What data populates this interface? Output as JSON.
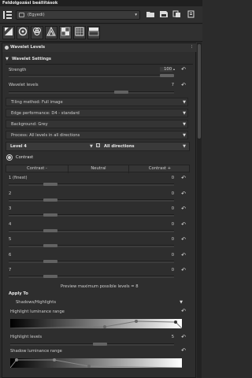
{
  "window": {
    "title": "Feldolgozási beállítások"
  },
  "toolbar": {
    "profile": "(Egyedi)"
  },
  "tabs": [
    "exposure",
    "detail",
    "color",
    "transform",
    "raw",
    "metadata"
  ],
  "sections": {
    "wavelet_levels": "Wavelet Levels",
    "wavelet_settings": "Wavelet Settings",
    "contrast": "Contrast",
    "apply_to": "Apply To"
  },
  "settings": {
    "strength_label": "Strength",
    "strength_value": "100",
    "strength_fraction": 1.0,
    "wavelet_levels_label": "Wavelet levels",
    "wavelet_levels_value": "7",
    "wavelet_levels_fraction": 0.7,
    "tiling_method": "Tiling method:   Full image",
    "edge_performance": "Edge performance:   D4 - standard",
    "background": "Background:   Grey",
    "process": "Process:   All levels in all directions",
    "level": "Level 4",
    "direction": "All directions"
  },
  "contrast": {
    "columns": [
      "Contrast -",
      "Neutral",
      "Contrast +"
    ],
    "rows": [
      {
        "label": "1 (finest)",
        "value": "0"
      },
      {
        "label": "2",
        "value": "0"
      },
      {
        "label": "3",
        "value": "0"
      },
      {
        "label": "4",
        "value": "0"
      },
      {
        "label": "5",
        "value": "0"
      },
      {
        "label": "6",
        "value": "0"
      },
      {
        "label": "7",
        "value": "0"
      }
    ],
    "preview_note": "Preview maximum possible levels = 8"
  },
  "apply_to": {
    "mode": "Shadows/Highlights",
    "highlight_range_label": "Highlight luminance range",
    "highlight_levels_label": "Highlight levels",
    "highlight_levels_value": "5",
    "highlight_levels_fraction": 0.55,
    "shadow_range_label": "Shadow luminance range"
  },
  "colors": {
    "background": "#2b2b2b",
    "panel": "#2e2e2e",
    "text": "#d6d6d6"
  }
}
